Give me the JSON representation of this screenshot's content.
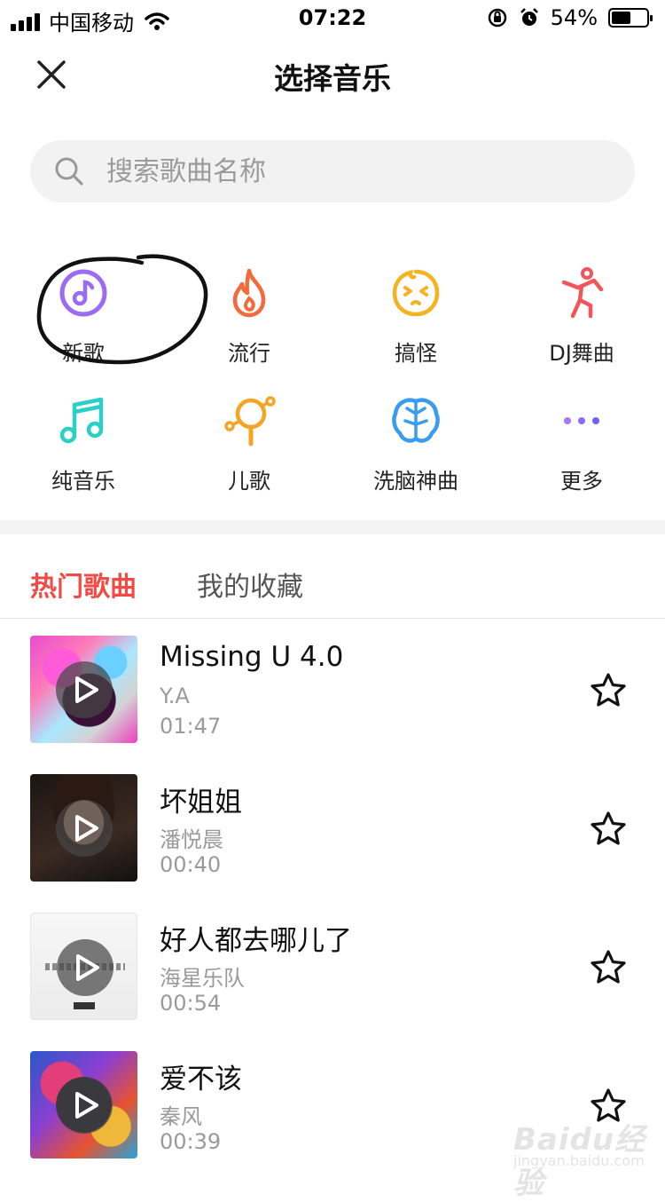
{
  "status_bar": {
    "carrier": "中国移动",
    "time": "07:22",
    "battery": "54%",
    "battery_level": 0.54
  },
  "nav": {
    "title": "选择音乐",
    "close_icon": "close-icon"
  },
  "search": {
    "placeholder": "搜索歌曲名称",
    "icon": "search-icon"
  },
  "categories": [
    {
      "label": "新歌",
      "icon": "music-note-icon",
      "color": "#9b6cf2"
    },
    {
      "label": "流行",
      "icon": "flame-icon",
      "color": "#f46a3c"
    },
    {
      "label": "搞怪",
      "icon": "funny-face-icon",
      "color": "#f5b321"
    },
    {
      "label": "DJ舞曲",
      "icon": "dancer-icon",
      "color": "#f2555a"
    },
    {
      "label": "纯音乐",
      "icon": "music-notes-icon",
      "color": "#2ccfc6"
    },
    {
      "label": "儿歌",
      "icon": "rattle-icon",
      "color": "#f7a425"
    },
    {
      "label": "洗脑神曲",
      "icon": "brain-icon",
      "color": "#3a9cf0"
    },
    {
      "label": "更多",
      "icon": "more-dots-icon",
      "color": "#8b6cf6"
    }
  ],
  "tabs": [
    {
      "label": "热门歌曲",
      "active": true
    },
    {
      "label": "我的收藏",
      "active": false
    }
  ],
  "songs": [
    {
      "title": "Missing U 4.0",
      "artist": "Y.A",
      "duration": "01:47"
    },
    {
      "title": "坏姐姐",
      "artist": "潘悦晨",
      "duration": "00:40"
    },
    {
      "title": "好人都去哪儿了",
      "artist": "海星乐队",
      "duration": "00:54"
    },
    {
      "title": "爱不该",
      "artist": "秦风",
      "duration": "00:39"
    }
  ],
  "watermark": {
    "text": "Baidu经验",
    "sub": "jingyan.baidu.com"
  },
  "colors": {
    "accent": "#f24a44",
    "secondary_text": "#9a9a9a"
  }
}
